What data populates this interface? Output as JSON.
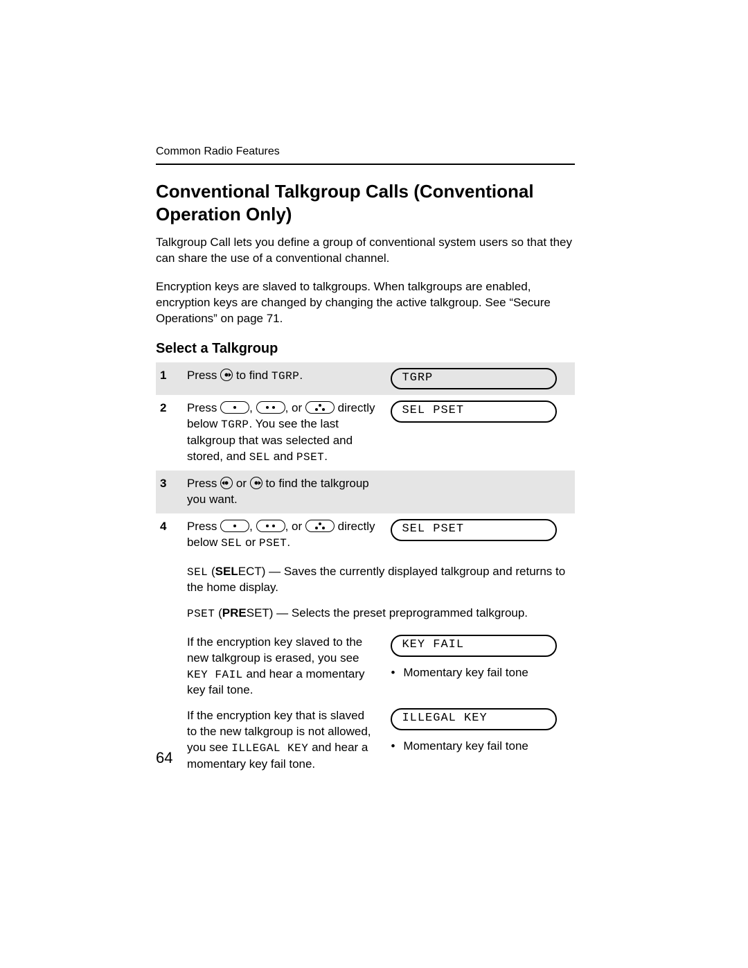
{
  "header": "Common Radio Features",
  "title": "Conventional Talkgroup Calls (Conventional Operation Only)",
  "intro1": "Talkgroup Call lets you define a group of conventional system users so that they can share the use of a conventional channel.",
  "intro2": "Encryption keys are slaved to talkgroups. When talkgroups are enabled, encryption keys are changed by changing the active talkgroup. See “Secure Operations” on page 71.",
  "subheading": "Select a Talkgroup",
  "steps": {
    "s1": {
      "num": "1",
      "pre": "Press ",
      "post": " to find ",
      "code": "TGRP",
      "tail": ".",
      "display": "TGRP"
    },
    "s2": {
      "num": "2",
      "pre": "Press ",
      "mid1": ", ",
      "mid2": ", or ",
      "post1": " directly below ",
      "code1": "TGRP",
      "post2": ". You see the last talkgroup that was selected and stored, and ",
      "code2": "SEL",
      "post3": " and ",
      "code3": "PSET",
      "tail": ".",
      "display": "SEL PSET"
    },
    "s3": {
      "num": "3",
      "pre": "Press ",
      "mid": " or ",
      "post": " to find the talkgroup you want."
    },
    "s4": {
      "num": "4",
      "pre": "Press ",
      "mid1": ", ",
      "mid2": ", or ",
      "post": " directly below ",
      "code1": "SEL",
      "post2": " or ",
      "code2": "PSET",
      "tail": ".",
      "display": "SEL PSET"
    }
  },
  "sel_line": {
    "code": "SEL",
    "label": "SEL",
    "bold": "ECT",
    "text": ") — Saves the currently displayed talkgroup and returns to the home display."
  },
  "pset_line": {
    "code": "PSET",
    "label": "PRE",
    "bold": "SET",
    "text": ") — Selects the preset preprogrammed talkgroup."
  },
  "keyfail": {
    "text_a": "If the encryption key slaved to the new talkgroup is erased, you see ",
    "code": "KEY FAIL",
    "text_b": " and hear a momentary key fail tone.",
    "display": "KEY FAIL",
    "bullet": "Momentary key fail tone"
  },
  "illegal": {
    "text_a": "If the encryption key that is slaved to the new talkgroup is not allowed, you see ",
    "code": "ILLEGAL KEY",
    "text_b": " and hear a momentary key fail tone.",
    "display": "ILLEGAL KEY",
    "bullet": "Momentary key fail tone"
  },
  "page_number": "64"
}
